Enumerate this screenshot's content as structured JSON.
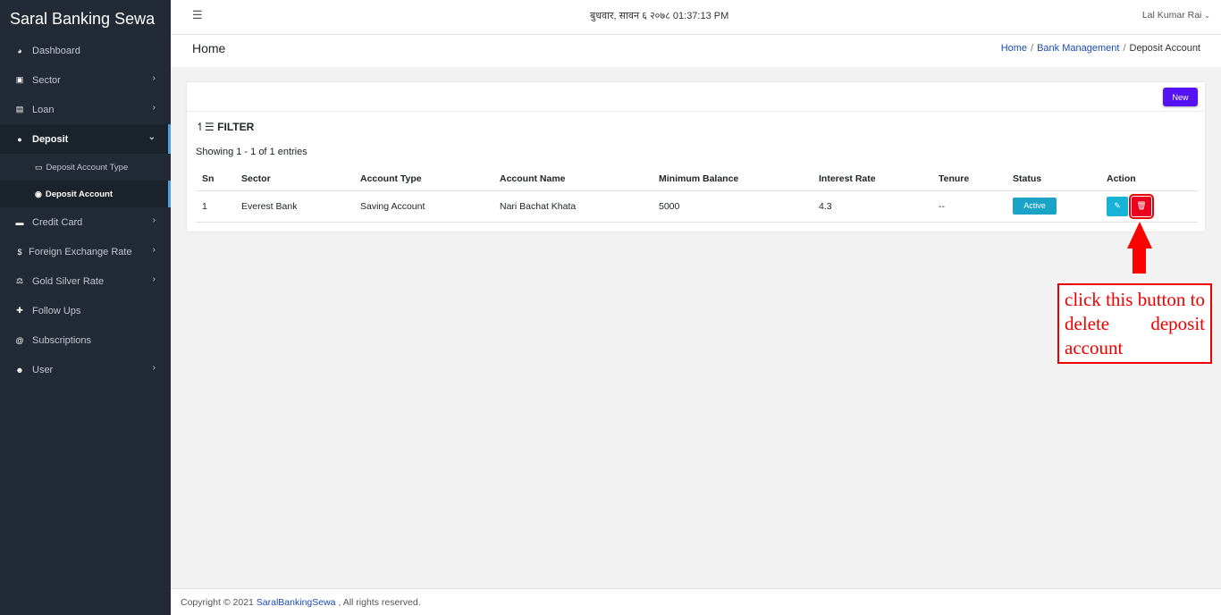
{
  "app": {
    "brand": "Saral Banking Sewa"
  },
  "sidebar": {
    "items": [
      {
        "label": "Dashboard",
        "icon": "dashboard-icon"
      },
      {
        "label": "Sector",
        "icon": "copy-icon"
      },
      {
        "label": "Loan",
        "icon": "money-icon"
      },
      {
        "label": "Deposit",
        "icon": "piggy-bank-icon"
      },
      {
        "label": "Credit Card",
        "icon": "credit-card-icon"
      },
      {
        "label": "Foreign Exchange Rate",
        "icon": "dollar-icon"
      },
      {
        "label": "Gold Silver Rate",
        "icon": "balance-icon"
      },
      {
        "label": "Follow Ups",
        "icon": "user-plus-icon"
      },
      {
        "label": "Subscriptions",
        "icon": "at-icon"
      },
      {
        "label": "User",
        "icon": "users-icon"
      }
    ],
    "deposit_sub": [
      {
        "label": "Deposit Account Type",
        "icon": "card-icon"
      },
      {
        "label": "Deposit Account",
        "icon": "user-circle-icon"
      }
    ]
  },
  "topbar": {
    "datetime": "बुधवार, सावन ६ २०७८ 01:37:13 PM",
    "user": "Lal Kumar Rai"
  },
  "header": {
    "title": "Home",
    "breadcrumb": [
      "Home",
      "Bank Management",
      "Deposit Account"
    ]
  },
  "card": {
    "new_label": "New",
    "filter_label": "FILTER",
    "showing": "Showing 1 - 1 of 1 entries"
  },
  "table": {
    "columns": [
      "Sn",
      "Sector",
      "Account Type",
      "Account Name",
      "Minimum Balance",
      "Interest Rate",
      "Tenure",
      "Status",
      "Action"
    ],
    "rows": [
      {
        "sn": "1",
        "sector": "Everest Bank",
        "account_type": "Saving Account",
        "account_name": "Nari Bachat Khata",
        "minimum_balance": "5000",
        "interest_rate": "4.3",
        "tenure": "--",
        "status": "Active"
      }
    ]
  },
  "annotation": {
    "text": "click this button to delete deposit account"
  },
  "footer": {
    "prefix": "Copyright © 2021 ",
    "link": "SaralBankingSewa",
    "suffix": " , All rights reserved."
  },
  "colors": {
    "accent": "#5412f5",
    "danger": "#e8001c",
    "info": "#17b3d6",
    "sidebar": "#212a35"
  }
}
